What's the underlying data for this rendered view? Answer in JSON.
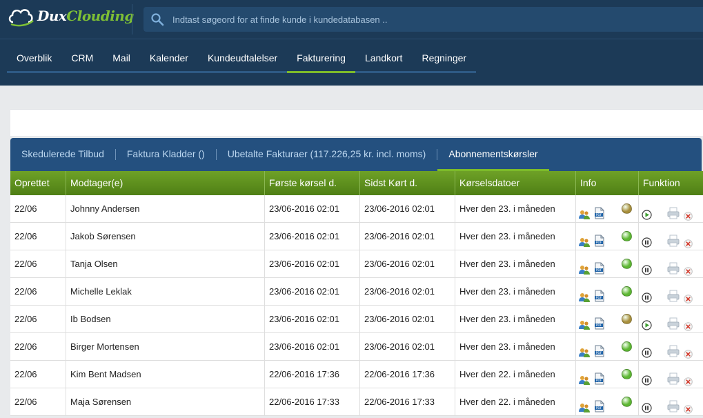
{
  "colors": {
    "topbar_bg": "#1c3a57",
    "accent_green": "#7dbb2a",
    "status_active": "#5db733",
    "status_paused": "#a88f3c",
    "play_green": "#3f9f32"
  },
  "logo": {
    "part1": "Dux",
    "part2": "Clouding",
    "icon": "cloud-logo-icon"
  },
  "search": {
    "placeholder": "Indtast søgeord for at finde kunde i kundedatabasen ..",
    "value": "",
    "icon": "search-icon"
  },
  "nav": {
    "items": [
      {
        "label": "Overblik",
        "active": false
      },
      {
        "label": "CRM",
        "active": false
      },
      {
        "label": "Mail",
        "active": false
      },
      {
        "label": "Kalender",
        "active": false
      },
      {
        "label": "Kundeudtalelser",
        "active": false
      },
      {
        "label": "Fakturering",
        "active": true
      },
      {
        "label": "Landkort",
        "active": false
      },
      {
        "label": "Regninger",
        "active": false
      }
    ]
  },
  "subtabs": [
    {
      "label": "Skedulerede Tilbud",
      "active": false
    },
    {
      "label": "Faktura Kladder ()",
      "active": false
    },
    {
      "label": "Ubetalte Fakturaer (117.226,25 kr. incl. moms)",
      "active": false
    },
    {
      "label": "Abonnementskørsler",
      "active": true
    }
  ],
  "table": {
    "headers": [
      "Oprettet",
      "Modtager(e)",
      "Første kørsel d.",
      "Sidst Kørt d.",
      "Kørselsdatoer",
      "Info",
      "Funktion"
    ],
    "rows": [
      {
        "created": "22/06",
        "recipient": "Johnny Andersen",
        "first_run": "23/06-2016 02:01",
        "last_run": "23/06-2016 02:01",
        "schedule": "Hver den 23. i måneden",
        "status": "paused",
        "control": "play"
      },
      {
        "created": "22/06",
        "recipient": "Jakob Sørensen",
        "first_run": "23/06-2016 02:01",
        "last_run": "23/06-2016 02:01",
        "schedule": "Hver den 23. i måneden",
        "status": "active",
        "control": "pause"
      },
      {
        "created": "22/06",
        "recipient": "Tanja Olsen",
        "first_run": "23/06-2016 02:01",
        "last_run": "23/06-2016 02:01",
        "schedule": "Hver den 23. i måneden",
        "status": "active",
        "control": "pause"
      },
      {
        "created": "22/06",
        "recipient": "Michelle Leklak",
        "first_run": "23/06-2016 02:01",
        "last_run": "23/06-2016 02:01",
        "schedule": "Hver den 23. i måneden",
        "status": "active",
        "control": "pause"
      },
      {
        "created": "22/06",
        "recipient": "Ib Bodsen",
        "first_run": "23/06-2016 02:01",
        "last_run": "23/06-2016 02:01",
        "schedule": "Hver den 23. i måneden",
        "status": "paused",
        "control": "play"
      },
      {
        "created": "22/06",
        "recipient": "Birger Mortensen",
        "first_run": "23/06-2016 02:01",
        "last_run": "23/06-2016 02:01",
        "schedule": "Hver den 23. i måneden",
        "status": "active",
        "control": "pause"
      },
      {
        "created": "22/06",
        "recipient": "Kim Bent Madsen",
        "first_run": "22/06-2016 17:36",
        "last_run": "22/06-2016 17:36",
        "schedule": "Hver den 22. i måneden",
        "status": "active",
        "control": "pause"
      },
      {
        "created": "22/06",
        "recipient": "Maja Sørensen",
        "first_run": "22/06-2016 17:33",
        "last_run": "22/06-2016 17:33",
        "schedule": "Hver den 22. i måneden",
        "status": "active",
        "control": "pause"
      }
    ]
  }
}
